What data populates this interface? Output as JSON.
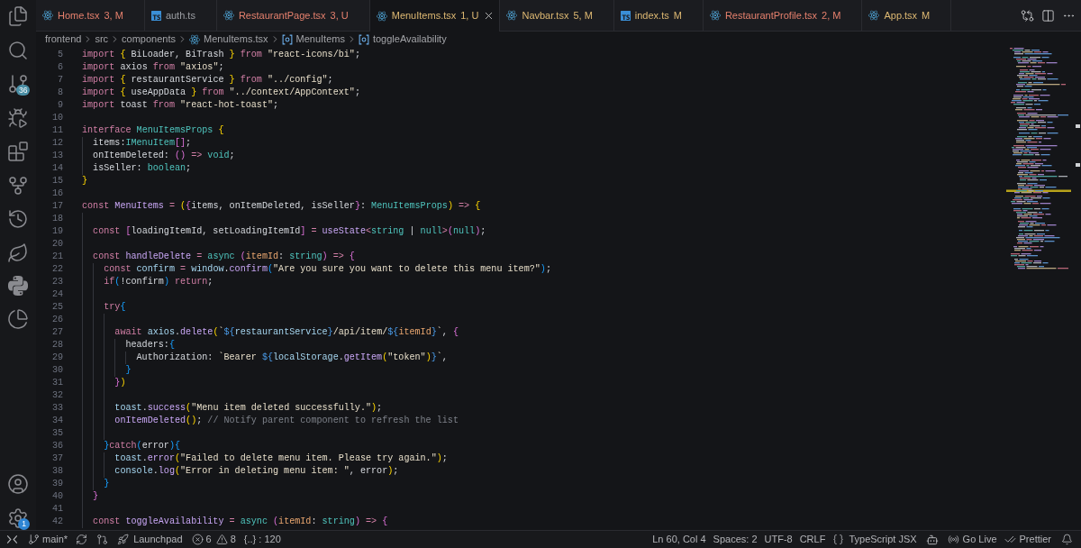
{
  "activity_bar": {
    "source_control_badge": "36",
    "settings_badge": "1"
  },
  "tabs": [
    {
      "label": "Home.tsx",
      "badge": "3, M",
      "kind": "tsx",
      "color": "#e5806d",
      "selected": false
    },
    {
      "label": "auth.ts",
      "kind": "ts",
      "color": "#9d9fa4",
      "selected": false
    },
    {
      "label": "RestaurantPage.tsx",
      "badge": "3, U",
      "kind": "tsx",
      "color": "#e5806d",
      "selected": false
    },
    {
      "label": "MenuItems.tsx",
      "badge": "1, U",
      "kind": "tsx",
      "color": "#ddb872",
      "selected": true
    },
    {
      "label": "Navbar.tsx",
      "badge": "5, M",
      "kind": "tsx",
      "color": "#ddb872",
      "selected": false
    },
    {
      "label": "index.ts",
      "badge": "M",
      "kind": "ts",
      "color": "#ddb872",
      "selected": false
    },
    {
      "label": "RestaurantProfile.tsx",
      "badge": "2, M",
      "kind": "tsx",
      "color": "#e5806d",
      "selected": false
    },
    {
      "label": "App.tsx",
      "badge": "M",
      "kind": "tsx",
      "color": "#ddb872",
      "selected": false
    }
  ],
  "breadcrumb": [
    {
      "label": "frontend",
      "kind": "folder"
    },
    {
      "label": "src",
      "kind": "folder"
    },
    {
      "label": "components",
      "kind": "folder"
    },
    {
      "label": "MenuItems.tsx",
      "kind": "file"
    },
    {
      "label": "MenuItems",
      "kind": "symbol"
    },
    {
      "label": "toggleAvailability",
      "kind": "symbol"
    }
  ],
  "editor": {
    "lines": [
      {
        "number": "5",
        "tokens": [
          {
            "kind": "keyword",
            "text": "import "
          },
          {
            "kind": "bracket1",
            "text": "{"
          },
          {
            "kind": "text",
            "text": " BiLoader, BiTrash "
          },
          {
            "kind": "bracket1",
            "text": "}"
          },
          {
            "kind": "keyword",
            "text": " from "
          },
          {
            "kind": "string",
            "text": "\"react-icons/bi\""
          },
          {
            "kind": "text",
            "text": ";"
          }
        ]
      },
      {
        "number": "6",
        "tokens": [
          {
            "kind": "keyword",
            "text": "import "
          },
          {
            "kind": "text",
            "text": "axios "
          },
          {
            "kind": "keyword",
            "text": "from "
          },
          {
            "kind": "string",
            "text": "\"axios\""
          },
          {
            "kind": "text",
            "text": ";"
          }
        ]
      },
      {
        "number": "7",
        "tokens": [
          {
            "kind": "keyword",
            "text": "import "
          },
          {
            "kind": "bracket1",
            "text": "{"
          },
          {
            "kind": "text",
            "text": " restaurantService "
          },
          {
            "kind": "bracket1",
            "text": "}"
          },
          {
            "kind": "keyword",
            "text": " from "
          },
          {
            "kind": "string",
            "text": "\"../config\""
          },
          {
            "kind": "text",
            "text": ";"
          }
        ]
      },
      {
        "number": "8",
        "tokens": [
          {
            "kind": "keyword",
            "text": "import "
          },
          {
            "kind": "bracket1",
            "text": "{"
          },
          {
            "kind": "text",
            "text": " useAppData "
          },
          {
            "kind": "bracket1",
            "text": "}"
          },
          {
            "kind": "keyword",
            "text": " from "
          },
          {
            "kind": "string",
            "text": "\"../context/AppContext\""
          },
          {
            "kind": "text",
            "text": ";"
          }
        ]
      },
      {
        "number": "9",
        "tokens": [
          {
            "kind": "keyword",
            "text": "import "
          },
          {
            "kind": "text",
            "text": "toast "
          },
          {
            "kind": "keyword",
            "text": "from "
          },
          {
            "kind": "string",
            "text": "\"react-hot-toast\""
          },
          {
            "kind": "text",
            "text": ";"
          }
        ]
      },
      {
        "number": "10"
      },
      {
        "number": "11",
        "tokens": [
          {
            "kind": "keyword",
            "text": "interface "
          },
          {
            "kind": "type",
            "text": "MenuItemsProps "
          },
          {
            "kind": "bracket1",
            "text": "{"
          }
        ],
        "children": [
          {
            "number": "12",
            "tokens": [
              {
                "kind": "text",
                "text": "items:"
              },
              {
                "kind": "type",
                "text": "IMenuItem"
              },
              {
                "kind": "bracket2",
                "text": "[]"
              },
              {
                "kind": "text",
                "text": ";"
              }
            ]
          },
          {
            "number": "13",
            "tokens": [
              {
                "kind": "text",
                "text": "onItemDeleted: "
              },
              {
                "kind": "bracket2",
                "text": "()"
              },
              {
                "kind": "keyword",
                "text": " => "
              },
              {
                "kind": "type",
                "text": "void"
              },
              {
                "kind": "text",
                "text": ";"
              }
            ]
          },
          {
            "number": "14",
            "tokens": [
              {
                "kind": "text",
                "text": "isSeller: "
              },
              {
                "kind": "type",
                "text": "boolean"
              },
              {
                "kind": "text",
                "text": ";"
              }
            ]
          }
        ]
      },
      {
        "number": "15",
        "tokens": [
          {
            "kind": "bracket1",
            "text": "}"
          }
        ]
      },
      {
        "number": "16"
      },
      {
        "number": "17",
        "tokens": [
          {
            "kind": "keyword",
            "text": "const "
          },
          {
            "kind": "function",
            "text": "MenuItems "
          },
          {
            "kind": "keyword",
            "text": "= "
          },
          {
            "kind": "bracket1",
            "text": "("
          },
          {
            "kind": "bracket2",
            "text": "{"
          },
          {
            "kind": "text",
            "text": "items, onItemDeleted, isSeller"
          },
          {
            "kind": "bracket2",
            "text": "}"
          },
          {
            "kind": "text",
            "text": ": "
          },
          {
            "kind": "type",
            "text": "MenuItemsProps"
          },
          {
            "kind": "bracket1",
            "text": ")"
          },
          {
            "kind": "keyword",
            "text": " => "
          },
          {
            "kind": "bracket1",
            "text": "{"
          }
        ],
        "children": [
          {
            "number": "18"
          },
          {
            "number": "19",
            "tokens": [
              {
                "kind": "keyword",
                "text": "const "
              },
              {
                "kind": "bracket2",
                "text": "["
              },
              {
                "kind": "text",
                "text": "loadingItemId, setLoadingItemId"
              },
              {
                "kind": "bracket2",
                "text": "]"
              },
              {
                "kind": "keyword",
                "text": " = "
              },
              {
                "kind": "function",
                "text": "useState"
              },
              {
                "kind": "keyword",
                "text": "<"
              },
              {
                "kind": "type",
                "text": "string"
              },
              {
                "kind": "text",
                "text": " | "
              },
              {
                "kind": "type",
                "text": "null"
              },
              {
                "kind": "keyword",
                "text": ">"
              },
              {
                "kind": "bracket2",
                "text": "("
              },
              {
                "kind": "type",
                "text": "null"
              },
              {
                "kind": "bracket2",
                "text": ")"
              },
              {
                "kind": "text",
                "text": ";"
              }
            ]
          },
          {
            "number": "20"
          },
          {
            "number": "21",
            "tokens": [
              {
                "kind": "keyword",
                "text": "const "
              },
              {
                "kind": "function",
                "text": "handleDelete "
              },
              {
                "kind": "keyword",
                "text": "= "
              },
              {
                "kind": "type",
                "text": "async "
              },
              {
                "kind": "bracket2",
                "text": "("
              },
              {
                "kind": "param",
                "text": "itemId"
              },
              {
                "kind": "text",
                "text": ": "
              },
              {
                "kind": "type",
                "text": "string"
              },
              {
                "kind": "bracket2",
                "text": ")"
              },
              {
                "kind": "keyword",
                "text": " => "
              },
              {
                "kind": "bracket2",
                "text": "{"
              }
            ],
            "children": [
              {
                "number": "22",
                "tokens": [
                  {
                    "kind": "keyword",
                    "text": "const "
                  },
                  {
                    "kind": "variable",
                    "text": "confirm "
                  },
                  {
                    "kind": "keyword",
                    "text": "= "
                  },
                  {
                    "kind": "variable",
                    "text": "window"
                  },
                  {
                    "kind": "text",
                    "text": "."
                  },
                  {
                    "kind": "function",
                    "text": "confirm"
                  },
                  {
                    "kind": "bracket3",
                    "text": "("
                  },
                  {
                    "kind": "string",
                    "text": "\"Are you sure you want to delete this menu item?\""
                  },
                  {
                    "kind": "bracket3",
                    "text": ")"
                  },
                  {
                    "kind": "text",
                    "text": ";"
                  }
                ]
              },
              {
                "number": "23",
                "tokens": [
                  {
                    "kind": "keyword",
                    "text": "if"
                  },
                  {
                    "kind": "bracket3",
                    "text": "("
                  },
                  {
                    "kind": "text",
                    "text": "!confirm"
                  },
                  {
                    "kind": "bracket3",
                    "text": ")"
                  },
                  {
                    "kind": "keyword",
                    "text": " return"
                  },
                  {
                    "kind": "text",
                    "text": ";"
                  }
                ]
              },
              {
                "number": "24"
              },
              {
                "number": "25",
                "tokens": [
                  {
                    "kind": "keyword",
                    "text": "try"
                  },
                  {
                    "kind": "bracket3",
                    "text": "{"
                  }
                ],
                "children": [
                  {
                    "number": "26"
                  },
                  {
                    "number": "27",
                    "tokens": [
                      {
                        "kind": "keyword",
                        "text": "await "
                      },
                      {
                        "kind": "variable",
                        "text": "axios"
                      },
                      {
                        "kind": "text",
                        "text": "."
                      },
                      {
                        "kind": "function",
                        "text": "delete"
                      },
                      {
                        "kind": "bracket1",
                        "text": "("
                      },
                      {
                        "kind": "string",
                        "text": "`"
                      },
                      {
                        "kind": "embed",
                        "text": "${"
                      },
                      {
                        "kind": "variable",
                        "text": "restaurantService"
                      },
                      {
                        "kind": "embed",
                        "text": "}"
                      },
                      {
                        "kind": "string",
                        "text": "/api/item/"
                      },
                      {
                        "kind": "embed",
                        "text": "${"
                      },
                      {
                        "kind": "param",
                        "text": "itemId"
                      },
                      {
                        "kind": "embed",
                        "text": "}"
                      },
                      {
                        "kind": "string",
                        "text": "`"
                      },
                      {
                        "kind": "text",
                        "text": ", "
                      },
                      {
                        "kind": "bracket2",
                        "text": "{"
                      }
                    ],
                    "children": [
                      {
                        "number": "28",
                        "tokens": [
                          {
                            "kind": "text",
                            "text": "headers:"
                          },
                          {
                            "kind": "bracket3",
                            "text": "{"
                          }
                        ],
                        "children": [
                          {
                            "number": "29",
                            "tokens": [
                              {
                                "kind": "text",
                                "text": "Authorization: "
                              },
                              {
                                "kind": "string",
                                "text": "`Bearer "
                              },
                              {
                                "kind": "embed",
                                "text": "${"
                              },
                              {
                                "kind": "variable",
                                "text": "localStorage"
                              },
                              {
                                "kind": "text",
                                "text": "."
                              },
                              {
                                "kind": "function",
                                "text": "getItem"
                              },
                              {
                                "kind": "bracket1",
                                "text": "("
                              },
                              {
                                "kind": "string",
                                "text": "\"token\""
                              },
                              {
                                "kind": "bracket1",
                                "text": ")"
                              },
                              {
                                "kind": "embed",
                                "text": "}"
                              },
                              {
                                "kind": "string",
                                "text": "`"
                              },
                              {
                                "kind": "text",
                                "text": ","
                              }
                            ]
                          }
                        ]
                      },
                      {
                        "number": "30",
                        "tokens": [
                          {
                            "kind": "bracket3",
                            "text": "}"
                          }
                        ]
                      }
                    ]
                  },
                  {
                    "number": "31",
                    "tokens": [
                      {
                        "kind": "bracket2",
                        "text": "}"
                      },
                      {
                        "kind": "bracket1",
                        "text": ")"
                      }
                    ]
                  },
                  {
                    "number": "32"
                  },
                  {
                    "number": "33",
                    "tokens": [
                      {
                        "kind": "variable",
                        "text": "toast"
                      },
                      {
                        "kind": "text",
                        "text": "."
                      },
                      {
                        "kind": "function",
                        "text": "success"
                      },
                      {
                        "kind": "bracket1",
                        "text": "("
                      },
                      {
                        "kind": "string",
                        "text": "\"Menu item deleted successfully.\""
                      },
                      {
                        "kind": "bracket1",
                        "text": ")"
                      },
                      {
                        "kind": "text",
                        "text": ";"
                      }
                    ]
                  },
                  {
                    "number": "34",
                    "tokens": [
                      {
                        "kind": "function",
                        "text": "onItemDeleted"
                      },
                      {
                        "kind": "bracket1",
                        "text": "()"
                      },
                      {
                        "kind": "text",
                        "text": "; "
                      },
                      {
                        "kind": "comment",
                        "text": "// Notify parent component to refresh the list"
                      }
                    ]
                  },
                  {
                    "number": "35"
                  }
                ]
              },
              {
                "number": "36",
                "tokens": [
                  {
                    "kind": "bracket3",
                    "text": "}"
                  },
                  {
                    "kind": "keyword",
                    "text": "catch"
                  },
                  {
                    "kind": "bracket3",
                    "text": "("
                  },
                  {
                    "kind": "text",
                    "text": "error"
                  },
                  {
                    "kind": "bracket3",
                    "text": ")"
                  },
                  {
                    "kind": "bracket3",
                    "text": "{"
                  }
                ],
                "children": [
                  {
                    "number": "37",
                    "tokens": [
                      {
                        "kind": "variable",
                        "text": "toast"
                      },
                      {
                        "kind": "text",
                        "text": "."
                      },
                      {
                        "kind": "function",
                        "text": "error"
                      },
                      {
                        "kind": "bracket1",
                        "text": "("
                      },
                      {
                        "kind": "string",
                        "text": "\"Failed to delete menu item. Please try again.\""
                      },
                      {
                        "kind": "bracket1",
                        "text": ")"
                      },
                      {
                        "kind": "text",
                        "text": ";"
                      }
                    ]
                  },
                  {
                    "number": "38",
                    "tokens": [
                      {
                        "kind": "variable",
                        "text": "console"
                      },
                      {
                        "kind": "text",
                        "text": "."
                      },
                      {
                        "kind": "function",
                        "text": "log"
                      },
                      {
                        "kind": "bracket1",
                        "text": "("
                      },
                      {
                        "kind": "string",
                        "text": "\"Error in deleting menu item: \""
                      },
                      {
                        "kind": "text",
                        "text": ", error"
                      },
                      {
                        "kind": "bracket1",
                        "text": ")"
                      },
                      {
                        "kind": "text",
                        "text": ";"
                      }
                    ]
                  }
                ]
              },
              {
                "number": "39",
                "tokens": [
                  {
                    "kind": "bracket3",
                    "text": "}"
                  }
                ]
              }
            ]
          },
          {
            "number": "40",
            "tokens": [
              {
                "kind": "bracket2",
                "text": "}"
              }
            ]
          },
          {
            "number": "41"
          },
          {
            "number": "42",
            "tokens": [
              {
                "kind": "keyword",
                "text": "const "
              },
              {
                "kind": "function",
                "text": "toggleAvailability "
              },
              {
                "kind": "keyword",
                "text": "= "
              },
              {
                "kind": "type",
                "text": "async "
              },
              {
                "kind": "bracket2",
                "text": "("
              },
              {
                "kind": "param",
                "text": "itemId"
              },
              {
                "kind": "text",
                "text": ": "
              },
              {
                "kind": "type",
                "text": "string"
              },
              {
                "kind": "bracket2",
                "text": ")"
              },
              {
                "kind": "keyword",
                "text": " => "
              },
              {
                "kind": "bracket2",
                "text": "{"
              }
            ]
          }
        ]
      }
    ]
  },
  "status_bar": {
    "left": [
      {
        "kind": "remote"
      },
      {
        "kind": "branch",
        "text": "main*"
      },
      {
        "kind": "sync"
      },
      {
        "kind": "review"
      },
      {
        "kind": "launchpad",
        "text": "Launchpad"
      },
      {
        "kind": "problems",
        "errors": "6",
        "warnings": "8"
      },
      {
        "kind": "plain",
        "text": "{..} : 120"
      }
    ],
    "right": [
      {
        "kind": "plain",
        "text": "Ln 60, Col 4"
      },
      {
        "kind": "plain",
        "text": "Spaces: 2"
      },
      {
        "kind": "plain",
        "text": "UTF-8"
      },
      {
        "kind": "plain",
        "text": "CRLF"
      },
      {
        "kind": "language",
        "text": "TypeScript JSX"
      },
      {
        "kind": "copilot"
      },
      {
        "kind": "live",
        "text": "Go Live"
      },
      {
        "kind": "formatter",
        "text": "Prettier"
      },
      {
        "kind": "notifications"
      }
    ]
  }
}
